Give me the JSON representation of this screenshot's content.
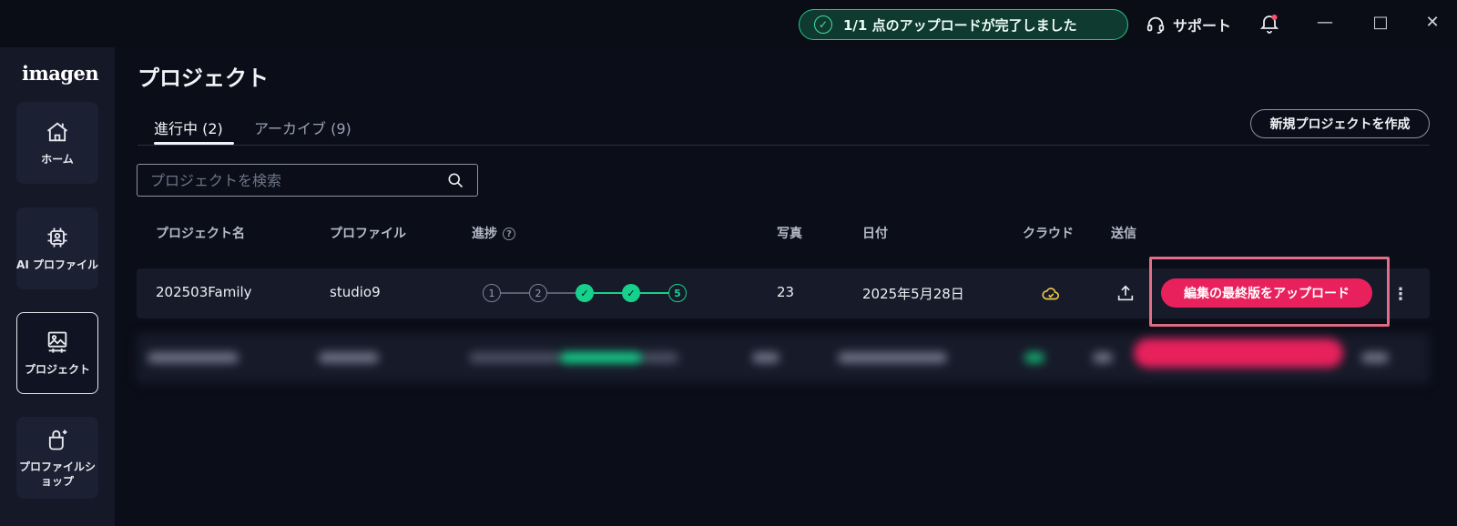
{
  "titlebar": {
    "upload_status": "1/1 点のアップロードが完了しました",
    "support_label": "サポート",
    "minimize_glyph": "—",
    "maximize_glyph": "□",
    "close_glyph": "✕",
    "success_color": "#22c98a",
    "notification_dot_color": "#ff4d6d"
  },
  "sidebar": {
    "logo_text": "imagen",
    "items": [
      {
        "label": "ホーム",
        "icon": "home-icon"
      },
      {
        "label": "AI プロファイル",
        "icon": "ai-profile-icon"
      },
      {
        "label": "プロジェクト",
        "icon": "project-icon",
        "active": true
      },
      {
        "label": "プロファイルショップ",
        "icon": "profile-shop-icon"
      }
    ]
  },
  "main": {
    "page_title": "プロジェクト",
    "tabs": [
      {
        "label": "進行中 (2)",
        "active": true
      },
      {
        "label": "アーカイブ (9)",
        "active": false
      }
    ],
    "new_project_label": "新規プロジェクトを作成",
    "search_placeholder": "プロジェクトを検索",
    "columns": {
      "name": "プロジェクト名",
      "profile": "プロファイル",
      "progress": "進捗",
      "photos": "写真",
      "date": "日付",
      "cloud": "クラウド",
      "send": "送信"
    },
    "rows": [
      {
        "name": "202503Family",
        "profile": "studio9",
        "progress_steps": [
          {
            "label": "1",
            "state": "pending"
          },
          {
            "label": "2",
            "state": "pending"
          },
          {
            "label": "✓",
            "state": "done"
          },
          {
            "label": "✓",
            "state": "done"
          },
          {
            "label": "5",
            "state": "current"
          }
        ],
        "photos": "23",
        "date": "2025年5月28日",
        "upload_final_label": "編集の最終版をアップロード",
        "more_glyph": "⋮"
      }
    ],
    "accent_color": "#e8215d",
    "progress_color": "#16d18c",
    "cloud_icon_color": "#f2c94c"
  }
}
